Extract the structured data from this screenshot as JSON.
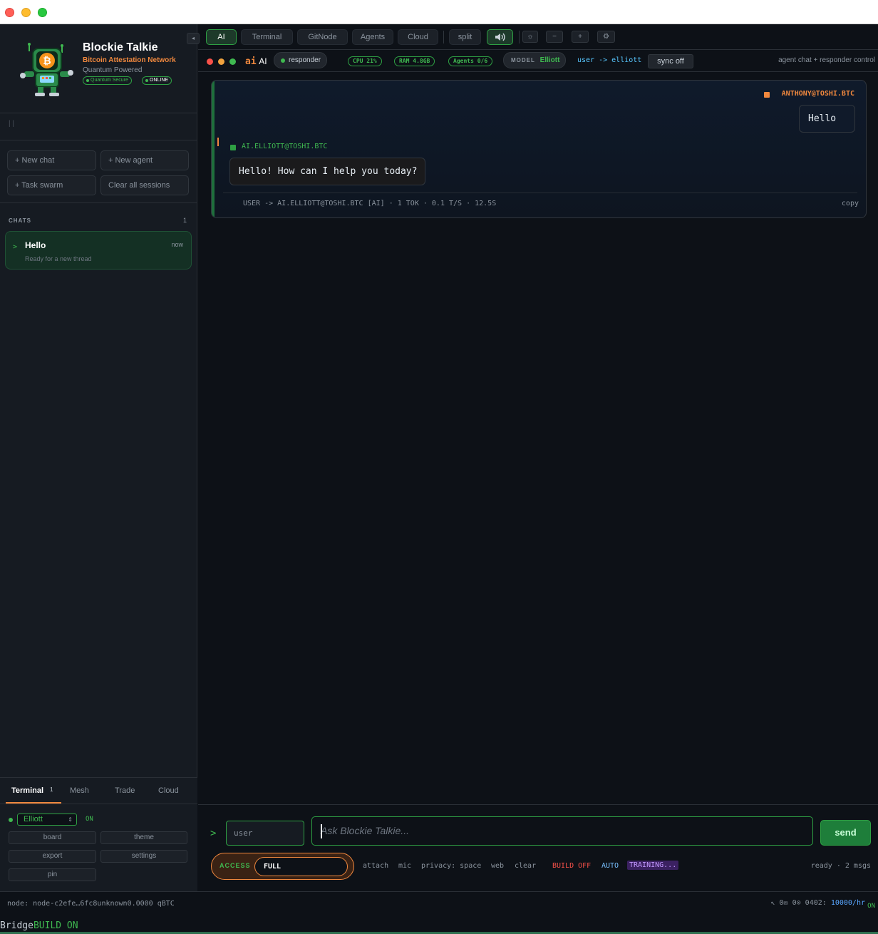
{
  "window": {
    "close_color": "#ff5f57",
    "minimize_color": "#febc2e",
    "maximize_color": "#28c840"
  },
  "sidebar": {
    "collapse_icon": "◂",
    "brand": {
      "title": "Blockie Talkie",
      "subtitle": "Bitcoin Attestation Network",
      "tagline": "Quantum Powered",
      "badge_secure": "Quantum Secure",
      "badge_online": "ONLINE"
    },
    "ticks": "| |",
    "actions": {
      "new_chat": "+ New chat",
      "new_agent": "+ New agent",
      "task_swarm": "+ Task swarm",
      "clear_all": "Clear all sessions"
    },
    "chats": {
      "header": "CHATS",
      "count": "1",
      "items": [
        {
          "chevron": ">",
          "title": "Hello",
          "time": "now",
          "subtitle": "Ready for a new thread"
        }
      ]
    },
    "bottom": {
      "tabs": [
        {
          "label": "Terminal",
          "badge": "1"
        },
        {
          "label": "Mesh"
        },
        {
          "label": "Trade"
        },
        {
          "label": "Cloud"
        }
      ],
      "model_select": "Elliott",
      "model_state": "ON",
      "buttons": {
        "board": "board",
        "theme": "theme",
        "export": "export",
        "settings": "settings",
        "pin": "pin"
      }
    }
  },
  "topbar": {
    "tabs": [
      "AI",
      "Terminal",
      "GitNode",
      "Agents",
      "Cloud"
    ],
    "split": "split",
    "tools": {
      "sun": "☼",
      "minus": "−",
      "plus": "+",
      "gear": "⚙"
    }
  },
  "statusbar": {
    "ai_prefix": "ai",
    "ai_label": "AI",
    "responder": "responder",
    "cpu": "CPU 21%",
    "ram": "RAM 4.8GB",
    "agents": "Agents 0/6",
    "model_label": "MODEL",
    "model_value": "Elliott",
    "route": "user -> elliott",
    "sync": "sync off",
    "hint": "agent chat + responder control"
  },
  "conversation": {
    "user_tag": "ANTHONY@TOSHI.BTC",
    "user_message": "Hello",
    "ai_tag": "AI.ELLIOTT@TOSHI.BTC",
    "ai_message": "Hello! How can I help you today?",
    "meta": "USER -> AI.ELLIOTT@TOSHI.BTC [AI] · 1 TOK · 0.1 T/S · 12.5S",
    "copy": "copy"
  },
  "composer": {
    "prompt": ">",
    "user_field": "user",
    "placeholder": "Ask Blockie Talkie...",
    "send": "send",
    "access_label": "ACCESS",
    "access_value": "FULL",
    "options": {
      "attach": "attach",
      "mic": "mic",
      "privacy": "privacy: space",
      "web": "web",
      "clear": "clear",
      "build": "BUILD OFF",
      "auto": "AUTO",
      "training": "TRAINING..."
    },
    "status": "ready · 2 msgs"
  },
  "footer": {
    "node": "node: node-c2efe…6fc8unknown0.0000 qBTC",
    "stats_prefix": "↖ 0✉ 0⊙ 0402:",
    "rate": "10000/hr",
    "on": "ON",
    "bridge": "Bridge",
    "build_on": "BUILD ON"
  }
}
